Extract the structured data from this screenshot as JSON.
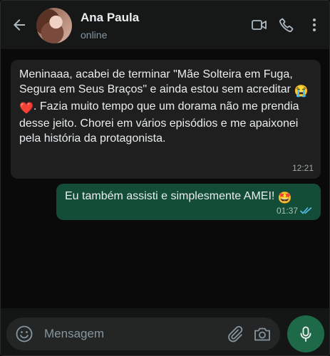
{
  "header": {
    "contact_name": "Ana Paula",
    "status": "online"
  },
  "messages": [
    {
      "direction": "incoming",
      "text_part1": "Meninaaa, acabei de terminar \"Mãe Solteira em Fuga, Segura em Seus Braços\" e ainda estou sem acreditar ",
      "emoji1": "😭",
      "emoji2": "❤️",
      "text_part2": ". Fazia muito tempo que um dorama não me prendia desse jeito. Chorei em vários episódios e me apaixonei pela história da protagonista.",
      "time": "12:21"
    },
    {
      "direction": "outgoing",
      "text": "Eu também assisti e simplesmente AMEI! ",
      "emoji": "🤩",
      "time": "01:37",
      "read": true
    }
  ],
  "composer": {
    "placeholder": "Mensagem"
  },
  "colors": {
    "incoming_bubble": "#1f1f1f",
    "outgoing_bubble": "#144d37",
    "read_ticks": "#53bdeb",
    "mic_button": "#1e6a48"
  },
  "icons": [
    "back-arrow-icon",
    "video-call-icon",
    "phone-icon",
    "more-vert-icon",
    "emoji-icon",
    "attach-icon",
    "camera-icon",
    "mic-icon",
    "double-check-icon"
  ]
}
